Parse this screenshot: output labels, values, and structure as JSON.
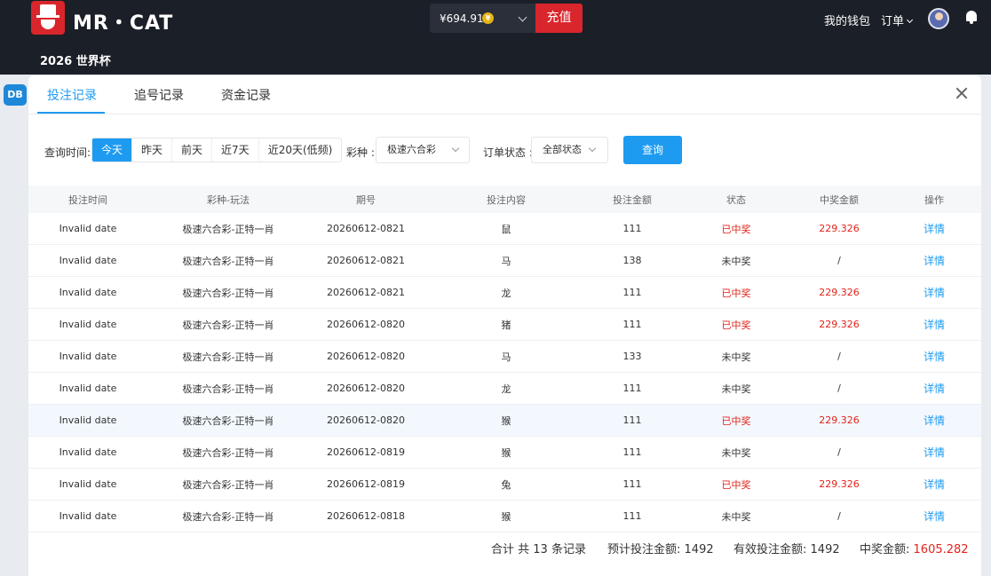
{
  "header": {
    "brand": "MR・CAT",
    "balance": "¥694.91",
    "coin_symbol": "¥",
    "recharge_label": "充值",
    "wallet_label": "我的钱包",
    "orders_label": "订单",
    "section_title": "2026 世界杯"
  },
  "background": {
    "badge": "DB"
  },
  "modal": {
    "tabs": [
      {
        "label": "投注记录",
        "active": true
      },
      {
        "label": "追号记录",
        "active": false
      },
      {
        "label": "资金记录",
        "active": false
      }
    ],
    "filters": {
      "time_label": "查询时间:",
      "time_options": [
        "今天",
        "昨天",
        "前天",
        "近7天",
        "近20天(低频)"
      ],
      "lottery_label": "彩种 :",
      "lottery_value": "极速六合彩",
      "status_label": "订单状态 :",
      "status_value": "全部状态",
      "query_label": "查询"
    },
    "table": {
      "columns": [
        "投注时间",
        "彩种-玩法",
        "期号",
        "投注内容",
        "投注金额",
        "状态",
        "中奖金额",
        "操作"
      ],
      "rows": [
        {
          "time": "Invalid date",
          "game": "极速六合彩-正特一肖",
          "issue": "20260612-0821",
          "content": "鼠",
          "amount": "111",
          "status": "已中奖",
          "prize": "229.326",
          "action": "详情"
        },
        {
          "time": "Invalid date",
          "game": "极速六合彩-正特一肖",
          "issue": "20260612-0821",
          "content": "马",
          "amount": "138",
          "status": "未中奖",
          "prize": "/",
          "action": "详情"
        },
        {
          "time": "Invalid date",
          "game": "极速六合彩-正特一肖",
          "issue": "20260612-0821",
          "content": "龙",
          "amount": "111",
          "status": "已中奖",
          "prize": "229.326",
          "action": "详情"
        },
        {
          "time": "Invalid date",
          "game": "极速六合彩-正特一肖",
          "issue": "20260612-0820",
          "content": "猪",
          "amount": "111",
          "status": "已中奖",
          "prize": "229.326",
          "action": "详情"
        },
        {
          "time": "Invalid date",
          "game": "极速六合彩-正特一肖",
          "issue": "20260612-0820",
          "content": "马",
          "amount": "133",
          "status": "未中奖",
          "prize": "/",
          "action": "详情"
        },
        {
          "time": "Invalid date",
          "game": "极速六合彩-正特一肖",
          "issue": "20260612-0820",
          "content": "龙",
          "amount": "111",
          "status": "未中奖",
          "prize": "/",
          "action": "详情"
        },
        {
          "time": "Invalid date",
          "game": "极速六合彩-正特一肖",
          "issue": "20260612-0820",
          "content": "猴",
          "amount": "111",
          "status": "已中奖",
          "prize": "229.326",
          "action": "详情"
        },
        {
          "time": "Invalid date",
          "game": "极速六合彩-正特一肖",
          "issue": "20260612-0819",
          "content": "猴",
          "amount": "111",
          "status": "未中奖",
          "prize": "/",
          "action": "详情"
        },
        {
          "time": "Invalid date",
          "game": "极速六合彩-正特一肖",
          "issue": "20260612-0819",
          "content": "兔",
          "amount": "111",
          "status": "已中奖",
          "prize": "229.326",
          "action": "详情"
        },
        {
          "time": "Invalid date",
          "game": "极速六合彩-正特一肖",
          "issue": "20260612-0818",
          "content": "猴",
          "amount": "111",
          "status": "未中奖",
          "prize": "/",
          "action": "详情"
        }
      ]
    },
    "summary": {
      "total_records": "合计 共 13 条记录",
      "expected_bet_label": "预计投注金额:",
      "expected_bet_value": "1492",
      "valid_bet_label": "有效投注金额:",
      "valid_bet_value": "1492",
      "prize_label": "中奖金额:",
      "prize_value": "1605.282"
    }
  },
  "colors": {
    "accent": "#1e9bf0",
    "win": "#e2231a",
    "brand_red": "#d9262c",
    "header_bg": "#1b1f27"
  }
}
